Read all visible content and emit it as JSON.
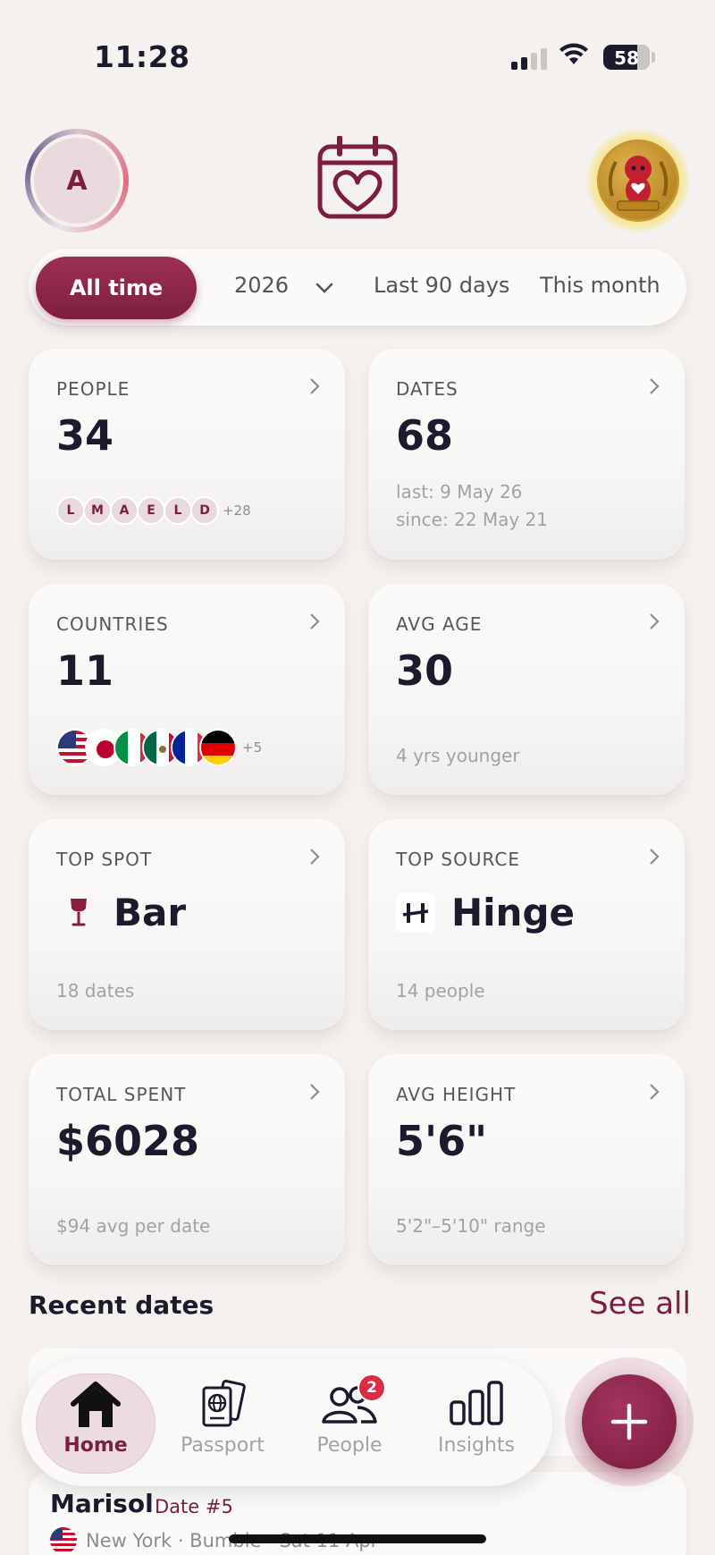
{
  "status": {
    "time": "11:28",
    "battery": "58"
  },
  "header": {
    "avatar_initial": "A"
  },
  "filters": {
    "active": "All time",
    "year": "2026",
    "last90": "Last 90 days",
    "month": "This month"
  },
  "cards": {
    "people": {
      "label": "PEOPLE",
      "value": "34",
      "initials": [
        "L",
        "M",
        "A",
        "E",
        "L",
        "D"
      ],
      "more": "+28"
    },
    "dates": {
      "label": "DATES",
      "value": "68",
      "last": "last: 9 May 26",
      "since": "since: 22 May 21"
    },
    "countries": {
      "label": "COUNTRIES",
      "value": "11",
      "more": "+5"
    },
    "avg_age": {
      "label": "AVG AGE",
      "value": "30",
      "sub": "4 yrs younger"
    },
    "top_spot": {
      "label": "TOP SPOT",
      "value": "Bar",
      "sub": "18 dates"
    },
    "top_source": {
      "label": "TOP SOURCE",
      "value": "Hinge",
      "sub": "14 people"
    },
    "total_spent": {
      "label": "TOTAL SPENT",
      "value": "$6028",
      "sub": "$94 avg per date"
    },
    "avg_height": {
      "label": "AVG HEIGHT",
      "value": "5'6\"",
      "sub": "5'2\"–5'10\" range"
    }
  },
  "recent": {
    "title": "Recent dates",
    "see_all": "See all",
    "item": {
      "name": "Marisol",
      "num": "Date #5",
      "meta": "New York · Bumble · Sat 11 Apr"
    }
  },
  "tabs": {
    "home": "Home",
    "passport": "Passport",
    "people": "People",
    "people_badge": "2",
    "insights": "Insights"
  },
  "colors": {
    "accent": "#7d1e40",
    "background": "#f4f1ee"
  }
}
